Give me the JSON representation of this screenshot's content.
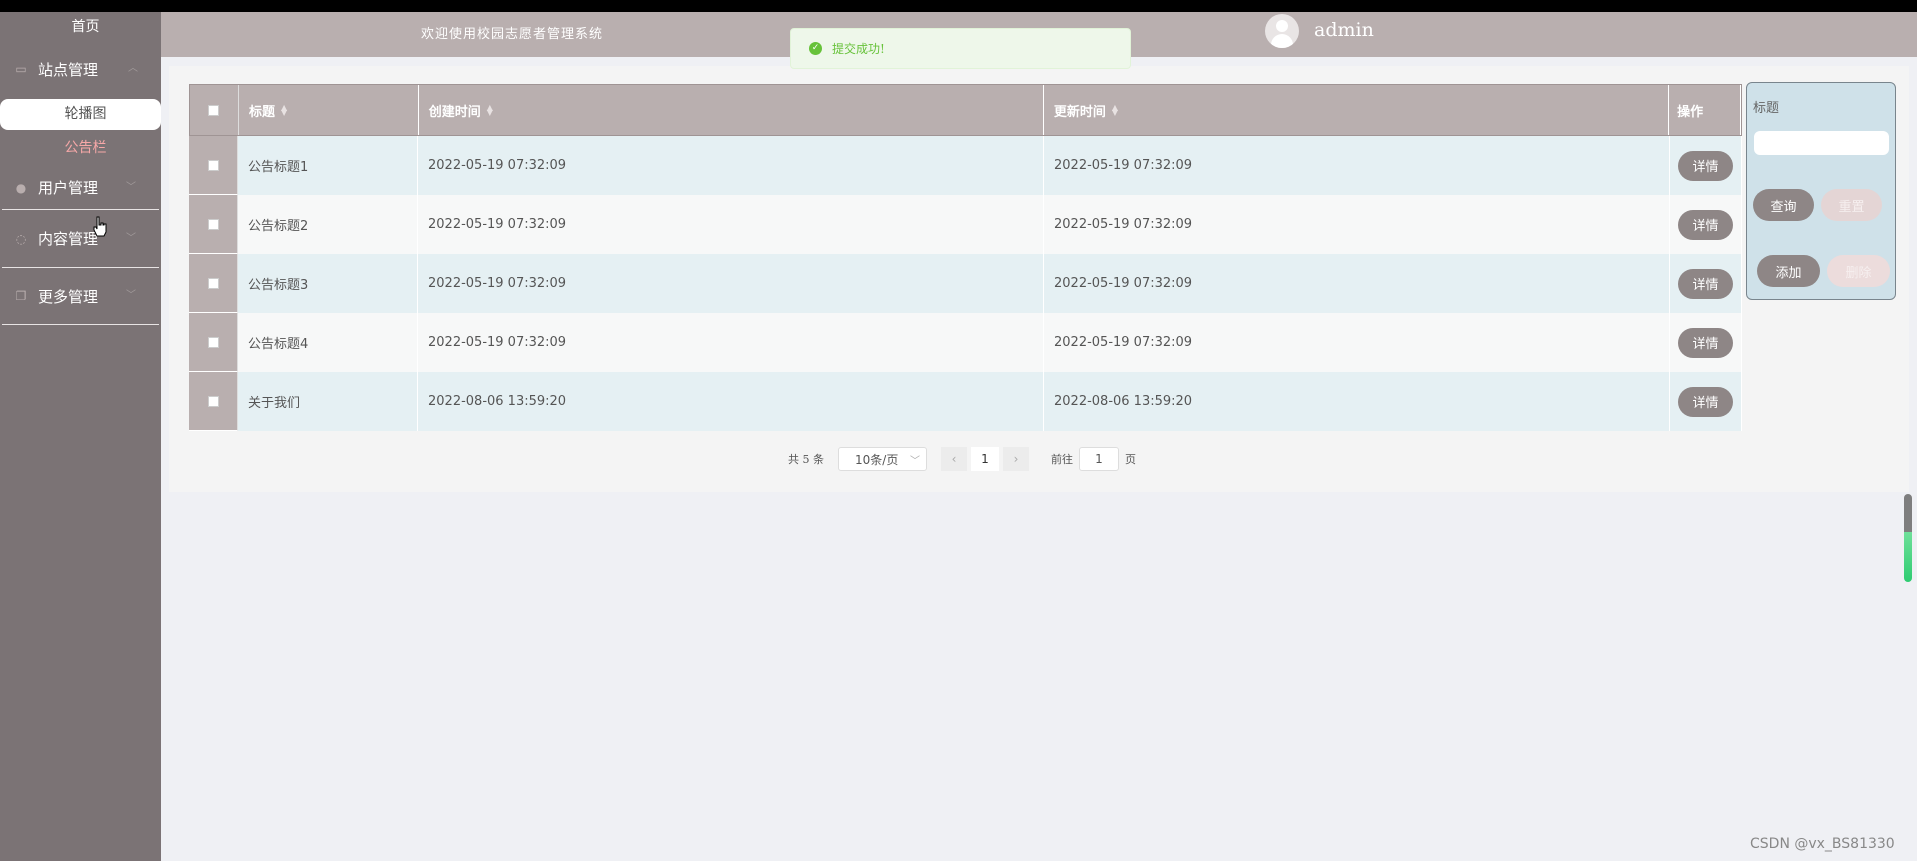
{
  "header": {
    "welcome": "欢迎使用校园志愿者管理系统",
    "username": "admin"
  },
  "toast": {
    "message": "提交成功!"
  },
  "sidebar": {
    "home": "首页",
    "groups": [
      {
        "label": "站点管理",
        "icon": "monitor-icon",
        "expanded": true,
        "children": [
          {
            "label": "轮播图",
            "active": true
          },
          {
            "label": "公告栏",
            "active": false
          }
        ]
      },
      {
        "label": "用户管理",
        "icon": "user-icon"
      },
      {
        "label": "内容管理",
        "icon": "chat-icon"
      },
      {
        "label": "更多管理",
        "icon": "copy-icon"
      }
    ]
  },
  "table": {
    "headers": {
      "title": "标题",
      "created": "创建时间",
      "updated": "更新时间",
      "op": "操作"
    },
    "rows": [
      {
        "title": "公告标题1",
        "created": "2022-05-19 07:32:09",
        "updated": "2022-05-19 07:32:09",
        "action": "详情"
      },
      {
        "title": "公告标题2",
        "created": "2022-05-19 07:32:09",
        "updated": "2022-05-19 07:32:09",
        "action": "详情"
      },
      {
        "title": "公告标题3",
        "created": "2022-05-19 07:32:09",
        "updated": "2022-05-19 07:32:09",
        "action": "详情"
      },
      {
        "title": "公告标题4",
        "created": "2022-05-19 07:32:09",
        "updated": "2022-05-19 07:32:09",
        "action": "详情"
      },
      {
        "title": "关于我们",
        "created": "2022-08-06 13:59:20",
        "updated": "2022-08-06 13:59:20",
        "action": "详情"
      }
    ]
  },
  "search": {
    "label": "标题",
    "input_value": "",
    "query": "查询",
    "reset": "重置",
    "add": "添加",
    "delete": "删除"
  },
  "pagination": {
    "total": "共 5 条",
    "page_size": "10条/页",
    "current_page": "1",
    "goto_label": "前往",
    "goto_value": "1",
    "unit": "页"
  },
  "watermark": "CSDN @vx_BS81330",
  "colors": {
    "sidebar": "#7b7375",
    "header": "#b9afaf",
    "accent": "#8e8686",
    "row_alt": "#e5f0f3",
    "success": "#67c23a"
  }
}
